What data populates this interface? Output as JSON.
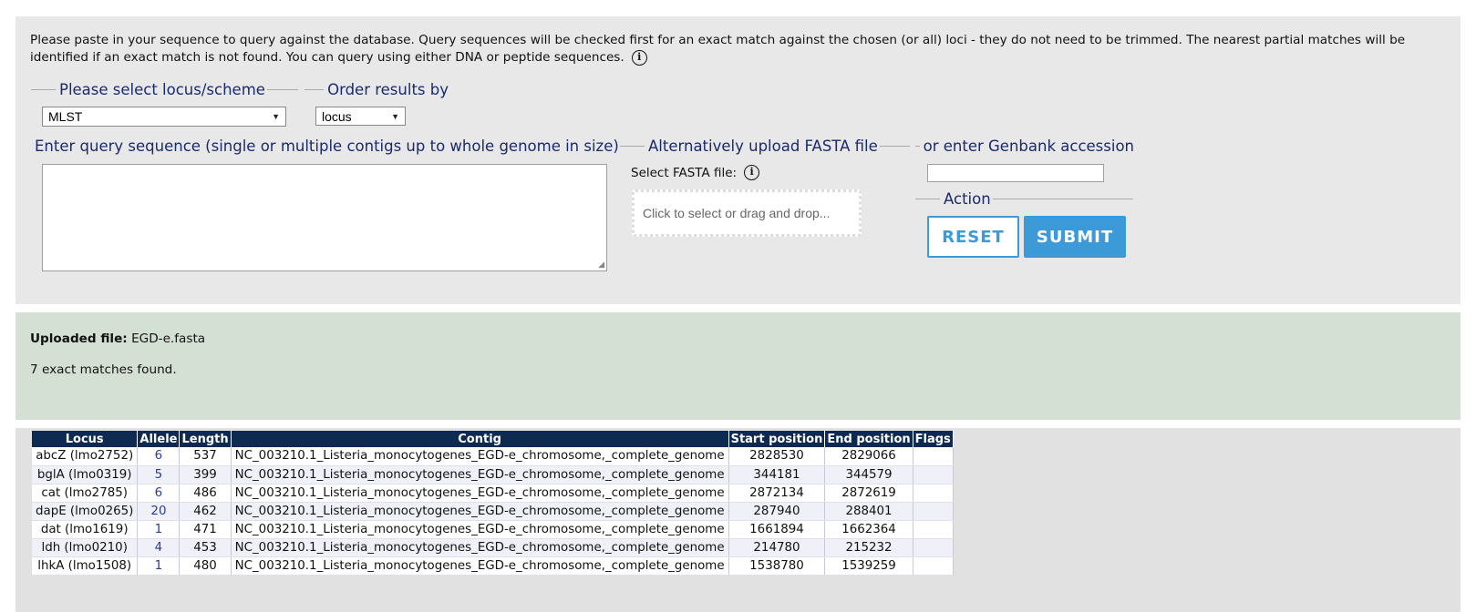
{
  "query": {
    "intro_text": "Please paste in your sequence to query against the database. Query sequences will be checked first for an exact match against the chosen (or all) loci - they do not need to be trimmed. The nearest partial matches will be identified if an exact match is not found. You can query using either DNA or peptide sequences.",
    "locus_legend": "Please select locus/scheme",
    "locus_value": "MLST",
    "order_legend": "Order results by",
    "order_value": "locus",
    "sequence_legend": "Enter query sequence (single or multiple contigs up to whole genome in size)",
    "sequence_value": "",
    "fasta_legend": "Alternatively upload FASTA file",
    "fasta_label": "Select FASTA file:",
    "dropzone_text": "Click to select or drag and drop...",
    "genbank_legend": "or enter Genbank accession",
    "genbank_value": "",
    "action_legend": "Action",
    "reset_label": "RESET",
    "submit_label": "SUBMIT",
    "info_icon": "info-circle-icon"
  },
  "result": {
    "uploaded_label": "Uploaded file:",
    "uploaded_file": "EGD-e.fasta",
    "matches_text": "7 exact matches found."
  },
  "table": {
    "headers": [
      "Locus",
      "Allele",
      "Length",
      "Contig",
      "Start position",
      "End position",
      "Flags"
    ],
    "rows": [
      {
        "locus": "abcZ (lmo2752)",
        "allele": "6",
        "length": "537",
        "contig": "NC_003210.1_Listeria_monocytogenes_EGD-e_chromosome,_complete_genome",
        "start": "2828530",
        "end": "2829066",
        "flags": ""
      },
      {
        "locus": "bglA (lmo0319)",
        "allele": "5",
        "length": "399",
        "contig": "NC_003210.1_Listeria_monocytogenes_EGD-e_chromosome,_complete_genome",
        "start": "344181",
        "end": "344579",
        "flags": ""
      },
      {
        "locus": "cat (lmo2785)",
        "allele": "6",
        "length": "486",
        "contig": "NC_003210.1_Listeria_monocytogenes_EGD-e_chromosome,_complete_genome",
        "start": "2872134",
        "end": "2872619",
        "flags": ""
      },
      {
        "locus": "dapE (lmo0265)",
        "allele": "20",
        "length": "462",
        "contig": "NC_003210.1_Listeria_monocytogenes_EGD-e_chromosome,_complete_genome",
        "start": "287940",
        "end": "288401",
        "flags": ""
      },
      {
        "locus": "dat (lmo1619)",
        "allele": "1",
        "length": "471",
        "contig": "NC_003210.1_Listeria_monocytogenes_EGD-e_chromosome,_complete_genome",
        "start": "1661894",
        "end": "1662364",
        "flags": ""
      },
      {
        "locus": "ldh (lmo0210)",
        "allele": "4",
        "length": "453",
        "contig": "NC_003210.1_Listeria_monocytogenes_EGD-e_chromosome,_complete_genome",
        "start": "214780",
        "end": "215232",
        "flags": ""
      },
      {
        "locus": "lhkA (lmo1508)",
        "allele": "1",
        "length": "480",
        "contig": "NC_003210.1_Listeria_monocytogenes_EGD-e_chromosome,_complete_genome",
        "start": "1538780",
        "end": "1539259",
        "flags": ""
      }
    ]
  },
  "colors": {
    "legend_text": "#1b2a6b",
    "button_blue": "#3d9ad8",
    "table_header": "#0e2a52",
    "result_panel": "#d5e0d5"
  }
}
